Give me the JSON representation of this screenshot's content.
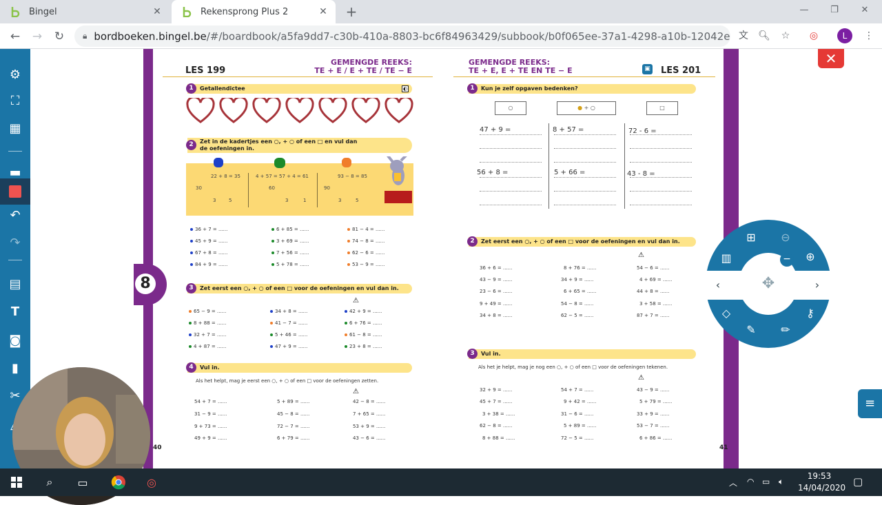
{
  "browser": {
    "tabs": [
      {
        "title": "Bingel",
        "active": false
      },
      {
        "title": "Rekensprong Plus 2",
        "active": true
      }
    ],
    "new_tab": "+",
    "url_host": "bordboeken.bingel.be",
    "url_path": "/#/boardbook/a5fa9dd7-c30b-410a-8803-bc6f84963429/subbook/b0f065ee-37a1-4298-a10b-12042e0bd224/pagespread/...",
    "profile_initial": "L",
    "colors": {
      "tabbar": "#dee1e6",
      "profile": "#7b1fa2"
    }
  },
  "app": {
    "colors": {
      "sidebar": "#1b75a6",
      "purple": "#7b2a8b",
      "yellow": "#fde48a",
      "close": "#e53935"
    },
    "close_label": "✕"
  },
  "left_page": {
    "les": "LES 199",
    "reeks_1": "GEMENGDE REEKS:",
    "reeks_2": "TE + E / E + TE / TE − E",
    "s1_title": "Getallendictee",
    "s2_title_1": "Zet in de kadertjes een ○,  + ○ of een □ en vul dan",
    "s2_title_2": "de oefeningen in.",
    "diagram_1": "22 + 8 = 35",
    "diagram_2": "4 + 57 = 57 + 4 = 61",
    "diagram_3": "93 − 8 = 85",
    "diagram_nums": [
      "30",
      "3",
      "5",
      "60",
      "3",
      "1",
      "90",
      "3",
      "5"
    ],
    "s2_col1": [
      "36 + 7 = ......",
      "45 + 9 = ......",
      "67 + 8 = ......",
      "84 + 9 = ......"
    ],
    "s2_col2": [
      "6 + 85 = ......",
      "3 + 69 = ......",
      "7 + 56 = ......",
      "5 + 78 = ......"
    ],
    "s2_col3": [
      "81 − 4 = ......",
      "74 − 8 = ......",
      "62 − 6 = ......",
      "53 − 9 = ......"
    ],
    "s3_title": "Zet eerst een ○,  + ○ of een □ voor de oefeningen en vul dan in.",
    "s3_col1": [
      "65 − 9 = ......",
      "8 + 88 = ......",
      "32 + 7 = ......",
      "4 + 87 = ......"
    ],
    "s3_col2": [
      "34 + 8 = ......",
      "41 − 7 = ......",
      "5 + 46 = ......",
      "47 + 9 = ......"
    ],
    "s3_col3": [
      "42 + 9 = ......",
      "6 + 76 = ......",
      "61 − 8 = ......",
      "23 + 8 = ......"
    ],
    "s4_title": "Vul in.",
    "s4_subtitle": "Als het helpt, mag je eerst een ○,  + ○ of een □ voor de oefeningen zetten.",
    "s4_col1": [
      "54 + 7 = ......",
      "31 − 9 = ......",
      "9 + 73 = ......",
      "49 + 9 = ......"
    ],
    "s4_col2": [
      "5 + 89 = ......",
      "45 − 8 = ......",
      "72 − 7 = ......",
      "6 + 79 = ......"
    ],
    "s4_col3": [
      "42 − 8 = ......",
      "7 + 65 = ......",
      "53 + 9 = ......",
      "43 − 6 = ......"
    ],
    "page_number": "40",
    "badge": "8"
  },
  "right_page": {
    "les": "LES 201",
    "reeks_1": "GEMENGDE REEKS:",
    "reeks_2": "TE + E, E + TE EN TE − E",
    "s1_title": "Kun je zelf opgaven bedenken?",
    "box_1": "○",
    "box_2": "+ ○",
    "box_3": "□",
    "hw": [
      "47 + 9 =",
      "8 + 57 =",
      "72 - 6 =",
      "56 + 8 =",
      "5 + 66 =",
      "43 - 8 ="
    ],
    "s2_title": "Zet eerst een ○,  + ○ of een □ voor de oefeningen en vul dan in.",
    "s2_col1": [
      "36 +  6 = ......",
      "43 −  9 = ......",
      "23 −  6 = ......",
      "9 + 49 = ......",
      "34 +  8 = ......"
    ],
    "s2_col2": [
      "8 + 76 = ......",
      "34 +  9 = ......",
      "6 + 65 = ......",
      "54 −  8 = ......",
      "62 −  5 = ......"
    ],
    "s2_col3": [
      "54 −  6 = ......",
      "4 + 69 = ......",
      "44 +  8 = ......",
      "3 + 58 = ......",
      "87 +  7 = ......"
    ],
    "s3_title": "Vul in.",
    "s3_subtitle": "Als het je helpt, mag je nog een ○,  + ○ of een □ voor de oefeningen tekenen.",
    "s3_col1": [
      "32 +  9 = ......",
      "45 +  7 = ......",
      "3 + 38 = ......",
      "62 −  8 = ......",
      "8 + 88 = ......"
    ],
    "s3_col2": [
      "54 +  7 = ......",
      "9 + 42 = ......",
      "31 −  6 = ......",
      "5 + 89 = ......",
      "72 −  5 = ......"
    ],
    "s3_col3": [
      "43 −  9 = ......",
      "5 + 79 = ......",
      "33 +  9 = ......",
      "53 −  7 = ......",
      "6 + 86 = ......"
    ],
    "page_number": "41"
  },
  "taskbar": {
    "time": "19:53",
    "date": "14/04/2020",
    "color": "#1d2a33"
  }
}
